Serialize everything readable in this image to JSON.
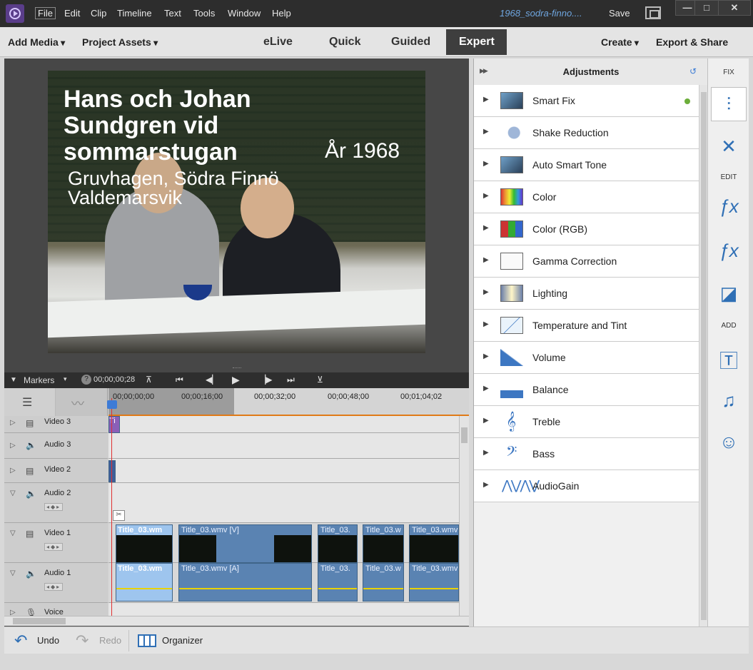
{
  "menubar": {
    "items": [
      "File",
      "Edit",
      "Clip",
      "Timeline",
      "Text",
      "Tools",
      "Window",
      "Help"
    ],
    "document_title": "1968_sodra-finno....",
    "save_label": "Save",
    "window_controls": {
      "minimize": "—",
      "maximize": "□",
      "close": "✕"
    }
  },
  "navbar": {
    "add_media": "Add Media",
    "project_assets": "Project Assets",
    "modes": [
      "eLive",
      "Quick",
      "Guided",
      "Expert"
    ],
    "selected_mode": "Expert",
    "create": "Create",
    "export_share": "Export & Share"
  },
  "monitor": {
    "title_line1": "Hans och Johan Sundgren vid sommarstugan",
    "year": "År 1968",
    "subtitle_line1": "Gruvhagen, Södra Finnö",
    "subtitle_line2": "Valdemarsvik"
  },
  "transport": {
    "markers_label": "Markers",
    "timecode": "00;00;00;28",
    "controls": [
      "set-in-icon",
      "go-to-start-icon",
      "step-back-icon",
      "play-icon",
      "step-forward-icon",
      "go-to-end-icon",
      "set-out-icon"
    ]
  },
  "timeline": {
    "ruler_ticks": [
      "00;00;00;00",
      "00;00;16;00",
      "00;00;32;00",
      "00;00;48;00",
      "00;01;04;02"
    ],
    "tracks": [
      {
        "name": "Video 3",
        "kind": "video"
      },
      {
        "name": "Audio 3",
        "kind": "audio"
      },
      {
        "name": "Video 2",
        "kind": "video"
      },
      {
        "name": "Audio 2",
        "kind": "audio"
      },
      {
        "name": "Video 1",
        "kind": "video"
      },
      {
        "name": "Audio 1",
        "kind": "audio"
      },
      {
        "name": "Voice",
        "kind": "voice"
      }
    ],
    "v3_clip_label": "Ti",
    "video1_clips": [
      "Title_03.wm",
      "Title_03.wmv [V]",
      "Title_03.",
      "Title_03.w",
      "Title_03.wmv"
    ],
    "audio1_clips": [
      "Title_03.wm",
      "Title_03.wmv [A]",
      "Title_03.",
      "Title_03.w",
      "Title_03.wmv"
    ]
  },
  "adjustments": {
    "header": "Adjustments",
    "items": [
      {
        "label": "Smart Fix",
        "icon": "smart-fix-icon",
        "active": true
      },
      {
        "label": "Shake Reduction",
        "icon": "shake-reduction-icon"
      },
      {
        "label": "Auto Smart Tone",
        "icon": "auto-smart-tone-icon"
      },
      {
        "label": "Color",
        "icon": "color-icon"
      },
      {
        "label": "Color (RGB)",
        "icon": "color-rgb-icon"
      },
      {
        "label": "Gamma Correction",
        "icon": "gamma-correction-icon"
      },
      {
        "label": "Lighting",
        "icon": "lighting-icon"
      },
      {
        "label": "Temperature and Tint",
        "icon": "temperature-tint-icon"
      },
      {
        "label": "Volume",
        "icon": "volume-icon"
      },
      {
        "label": "Balance",
        "icon": "balance-icon"
      },
      {
        "label": "Treble",
        "icon": "treble-clef-icon"
      },
      {
        "label": "Bass",
        "icon": "bass-clef-icon"
      },
      {
        "label": "AudioGain",
        "icon": "audio-gain-icon"
      }
    ],
    "active_dot_color": "#6cae3a"
  },
  "toolcol": {
    "fix_label": "FIX",
    "edit_label": "EDIT",
    "add_label": "ADD"
  },
  "bottombar": {
    "undo": "Undo",
    "redo": "Redo",
    "organizer": "Organizer"
  },
  "colors": {
    "accent_blue": "#2f6fb5",
    "link_blue": "#6fa6e0",
    "playhead_red": "#e03030",
    "ruler_orange": "#e07a17",
    "clip_blue": "#5a83b2",
    "clip_selected": "#9ec5ee"
  }
}
